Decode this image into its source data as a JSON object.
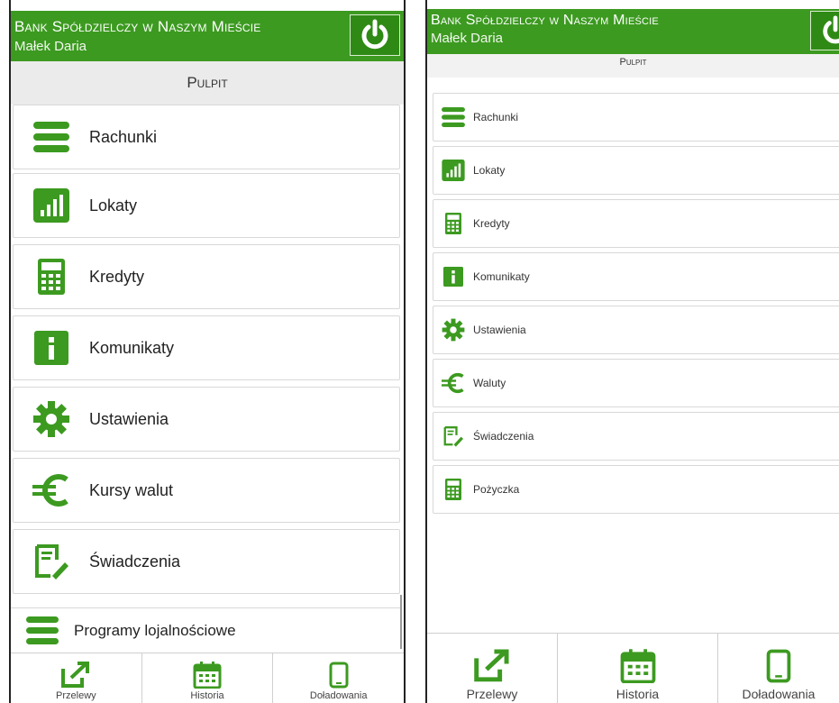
{
  "accent_color": "#3c9a20",
  "left_screen": {
    "header": {
      "bank_name": "Bank Spółdzielczy w Naszym Mieście",
      "user_name": "Małek Daria",
      "power_icon": "power-icon"
    },
    "subtitle": "Pulpit",
    "menu": [
      {
        "label": "Rachunki",
        "icon": "list-icon"
      },
      {
        "label": "Lokaty",
        "icon": "bar-chart-icon"
      },
      {
        "label": "Kredyty",
        "icon": "calculator-icon"
      },
      {
        "label": "Komunikaty",
        "icon": "info-icon"
      },
      {
        "label": "Ustawienia",
        "icon": "gear-icon"
      },
      {
        "label": "Kursy walut",
        "icon": "euro-icon"
      },
      {
        "label": "Świadczenia",
        "icon": "document-edit-icon"
      }
    ],
    "overflow_item": {
      "label": "Programy lojalnościowe",
      "icon": "list-icon"
    },
    "bottom_nav": [
      {
        "label": "Przelewy",
        "icon": "transfer-icon"
      },
      {
        "label": "Historia",
        "icon": "calendar-icon"
      },
      {
        "label": "Doładowania",
        "icon": "phone-icon"
      }
    ]
  },
  "right_screen": {
    "header": {
      "bank_name": "Bank Spółdzielczy w Naszym Mieście",
      "user_name": "Małek Daria",
      "power_icon": "power-icon"
    },
    "subtitle": "Pulpit",
    "menu": [
      {
        "label": "Rachunki",
        "icon": "list-icon"
      },
      {
        "label": "Lokaty",
        "icon": "bar-chart-icon"
      },
      {
        "label": "Kredyty",
        "icon": "calculator-icon"
      },
      {
        "label": "Komunikaty",
        "icon": "info-icon"
      },
      {
        "label": "Ustawienia",
        "icon": "gear-icon"
      },
      {
        "label": "Waluty",
        "icon": "euro-icon"
      },
      {
        "label": "Świadczenia",
        "icon": "document-edit-icon"
      },
      {
        "label": "Pożyczka",
        "icon": "calculator-icon"
      }
    ],
    "bottom_nav": [
      {
        "label": "Przelewy",
        "icon": "transfer-icon"
      },
      {
        "label": "Historia",
        "icon": "calendar-icon"
      },
      {
        "label": "Doładowania",
        "icon": "phone-icon"
      }
    ]
  }
}
